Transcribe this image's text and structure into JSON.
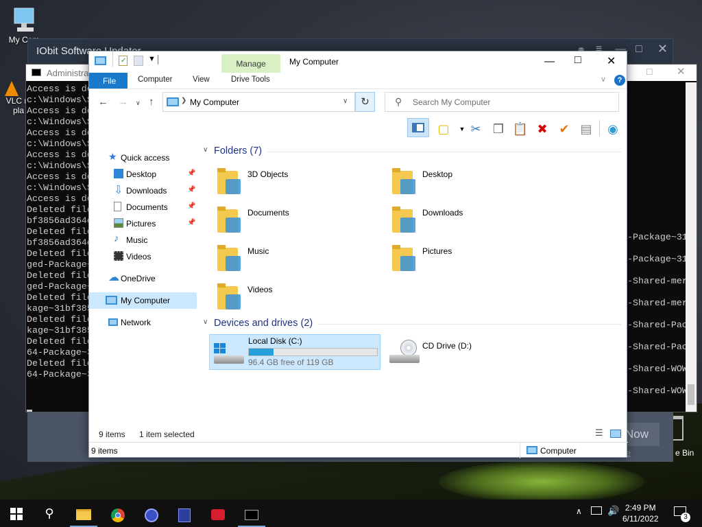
{
  "desktop": {
    "icons": [
      {
        "label": "My Com"
      },
      {
        "label": "VLC m"
      },
      {
        "label": "pla"
      }
    ],
    "recycle_label": "e Bin"
  },
  "iobit": {
    "title": "IObit Software Updater",
    "button_label": "Now",
    "link_label": "ide"
  },
  "cmd": {
    "title": "Administrat",
    "lines": [
      "Access is de",
      "c:\\Windows\\S",
      "Access is de",
      "c:\\Windows\\S",
      "Access is de",
      "c:\\Windows\\S",
      "Access is de",
      "c:\\Windows\\S",
      "Access is de",
      "c:\\Windows\\S",
      "Access is de",
      "Deleted file",
      "bf3856ad364e",
      "Deleted file",
      "bf3856ad364e",
      "Deleted file",
      "ged-Package~",
      "Deleted file",
      "ged-Package~",
      "Deleted file",
      "kage~31bf385",
      "Deleted file",
      "kage~31bf385",
      "Deleted file",
      "64-Package~3",
      "Deleted file",
      "64-Package~3"
    ],
    "right_lines": [
      "-Package~31",
      "-Package~31",
      "-Shared-mer",
      "-Shared-mer",
      "-Shared-Pac",
      "-Shared-Pac",
      "-Shared-WOW",
      "-Shared-WOW"
    ]
  },
  "explorer": {
    "title": "My Computer",
    "manage_label": "Manage",
    "tabs": {
      "file": "File",
      "computer": "Computer",
      "view": "View",
      "drive_tools": "Drive Tools"
    },
    "address": "My Computer",
    "search_placeholder": "Search My Computer",
    "nav": {
      "quick_access": "Quick access",
      "desktop": "Desktop",
      "downloads": "Downloads",
      "documents": "Documents",
      "pictures": "Pictures",
      "music": "Music",
      "videos": "Videos",
      "onedrive": "OneDrive",
      "my_computer": "My Computer",
      "network": "Network"
    },
    "folders_header": "Folders (7)",
    "folders": [
      "3D Objects",
      "Desktop",
      "Documents",
      "Downloads",
      "Music",
      "Pictures",
      "Videos"
    ],
    "devices_header": "Devices and drives (2)",
    "drives": [
      {
        "name": "Local Disk (C:)",
        "free": "96.4 GB free of 119 GB",
        "used_fraction": 0.19
      },
      {
        "name": "CD Drive (D:)"
      }
    ],
    "status": {
      "items": "9 items",
      "selected": "1 item selected",
      "bottom_items": "9 items",
      "bottom_location": "Computer"
    }
  },
  "taskbar": {
    "time": "2:49 PM",
    "date": "6/11/2022",
    "notif_count": "3"
  },
  "colors": {
    "accent": "#1979ca",
    "selection": "#cce8ff",
    "folder": "#f5c94f"
  }
}
